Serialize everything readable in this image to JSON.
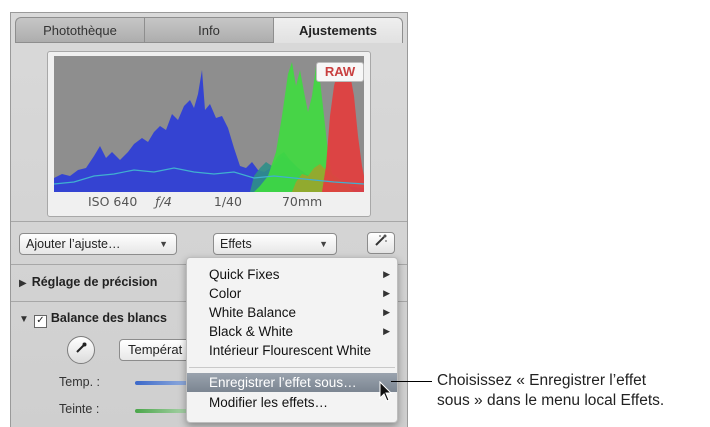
{
  "tabs": [
    {
      "label": "Photothèque"
    },
    {
      "label": "Info"
    },
    {
      "label": "Ajustements"
    }
  ],
  "histogram": {
    "badge": "RAW",
    "exif": {
      "iso": "ISO 640",
      "aperture": "ƒ/4",
      "shutter": "1/40",
      "focal": "70mm"
    }
  },
  "toolbar": {
    "add_adjustment": "Ajouter l’ajuste…",
    "effects": "Effets",
    "popup_arrow": "▼",
    "wand_icon": "magic-wand"
  },
  "sections": {
    "fine_tuning": "Réglage de précision",
    "white_balance": "Balance des blancs",
    "white_balance_checked": true,
    "wb_mode": "Températ",
    "temp_label": "Temp. :",
    "tint_label": "Teinte :"
  },
  "menu": {
    "items": [
      {
        "label": "Quick Fixes",
        "submenu": true
      },
      {
        "label": "Color",
        "submenu": true
      },
      {
        "label": "White Balance",
        "submenu": true
      },
      {
        "label": "Black & White",
        "submenu": true
      },
      {
        "label": "Intérieur Flourescent White",
        "submenu": false
      },
      {
        "label": "Enregistrer l’effet sous…",
        "submenu": false,
        "highlighted": true
      },
      {
        "label": "Modifier les effets…",
        "submenu": false
      }
    ],
    "submenu_glyph": "▶"
  },
  "callout": {
    "line1": "Choisissez « Enregistrer l’effet",
    "line2": "sous » dans le menu local Effets."
  },
  "colors": {
    "histo_bg": "#8e8e8e",
    "blue_channel": "#2f3fd6",
    "green_channel": "#3fdc3f",
    "red_channel": "#e04040",
    "menu_highlight": "#7b8591",
    "raw_text": "#c94040"
  }
}
